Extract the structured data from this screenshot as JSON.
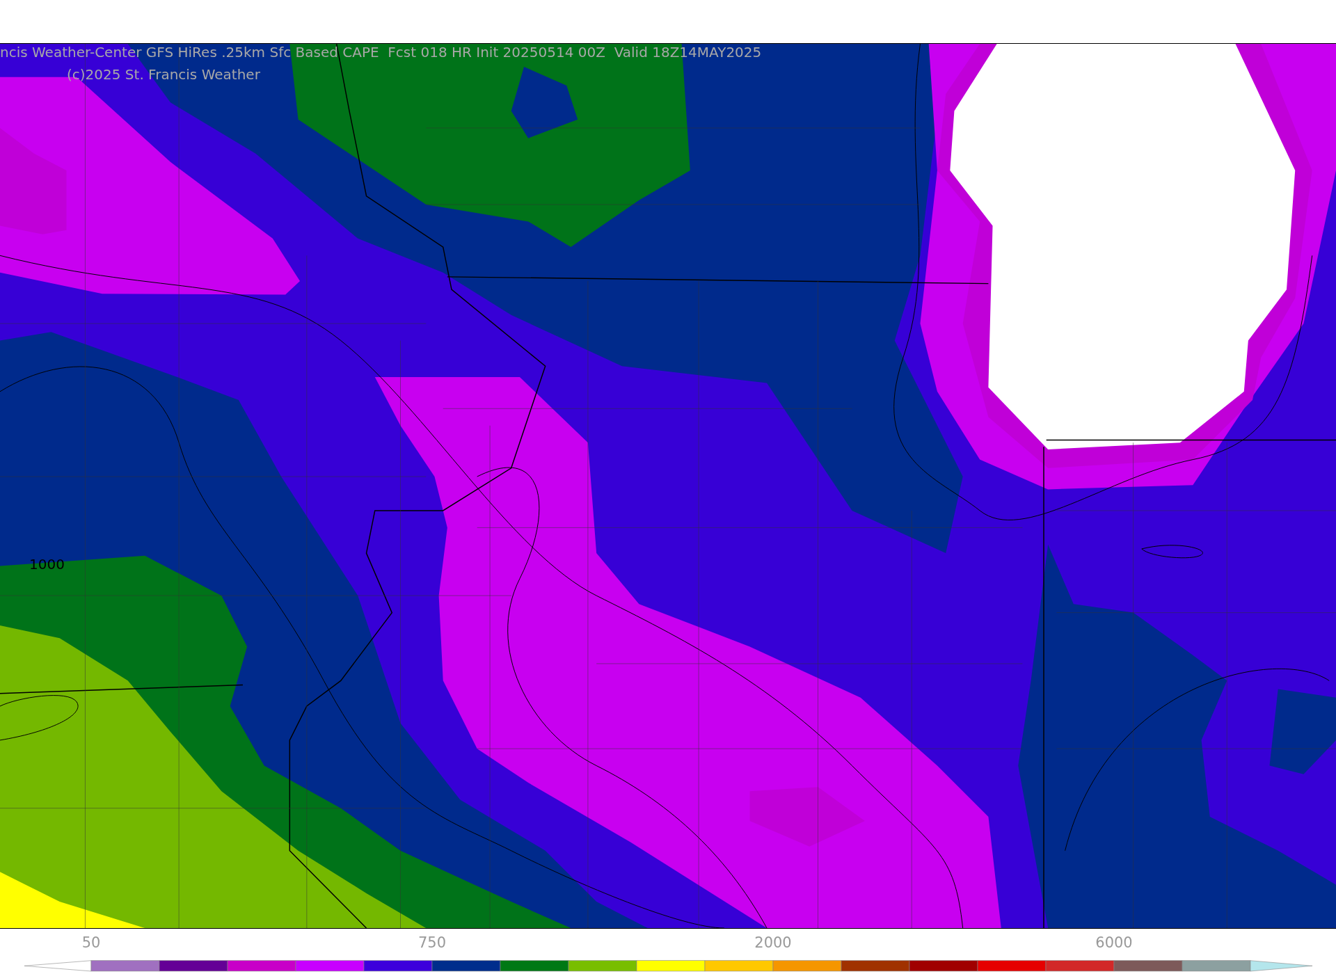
{
  "map": {
    "title": "ncis Weather-Center GFS HiRes .25km Sfc Based CAPE  Fcst 018 HR Init 20250514 00Z  Valid 18Z14MAY2025",
    "copyright": "(c)2025 St. Francis Weather",
    "contour_label": "1000"
  },
  "colorbar": {
    "segments": [
      {
        "kind": "low-arrow",
        "color": "#ffffff"
      },
      {
        "kind": "box",
        "color": "#a070c0",
        "tick": "50"
      },
      {
        "kind": "box",
        "color": "#640096"
      },
      {
        "kind": "box",
        "color": "#c800c8"
      },
      {
        "kind": "box",
        "color": "#c800ff"
      },
      {
        "kind": "box",
        "color": "#3c00dc"
      },
      {
        "kind": "box",
        "color": "#002d8c",
        "tick": "750"
      },
      {
        "kind": "box",
        "color": "#007814"
      },
      {
        "kind": "box",
        "color": "#78be00"
      },
      {
        "kind": "box",
        "color": "#ffff00"
      },
      {
        "kind": "box",
        "color": "#ffc800"
      },
      {
        "kind": "box",
        "color": "#f59600",
        "tick": "2000"
      },
      {
        "kind": "box",
        "color": "#a03200"
      },
      {
        "kind": "box",
        "color": "#a00000"
      },
      {
        "kind": "box",
        "color": "#e60000"
      },
      {
        "kind": "box",
        "color": "#d22828"
      },
      {
        "kind": "box",
        "color": "#7d5a5a",
        "tick": "6000"
      },
      {
        "kind": "box",
        "color": "#8ca0a0"
      },
      {
        "kind": "high-arrow",
        "color": "#b4e6ec"
      }
    ]
  }
}
